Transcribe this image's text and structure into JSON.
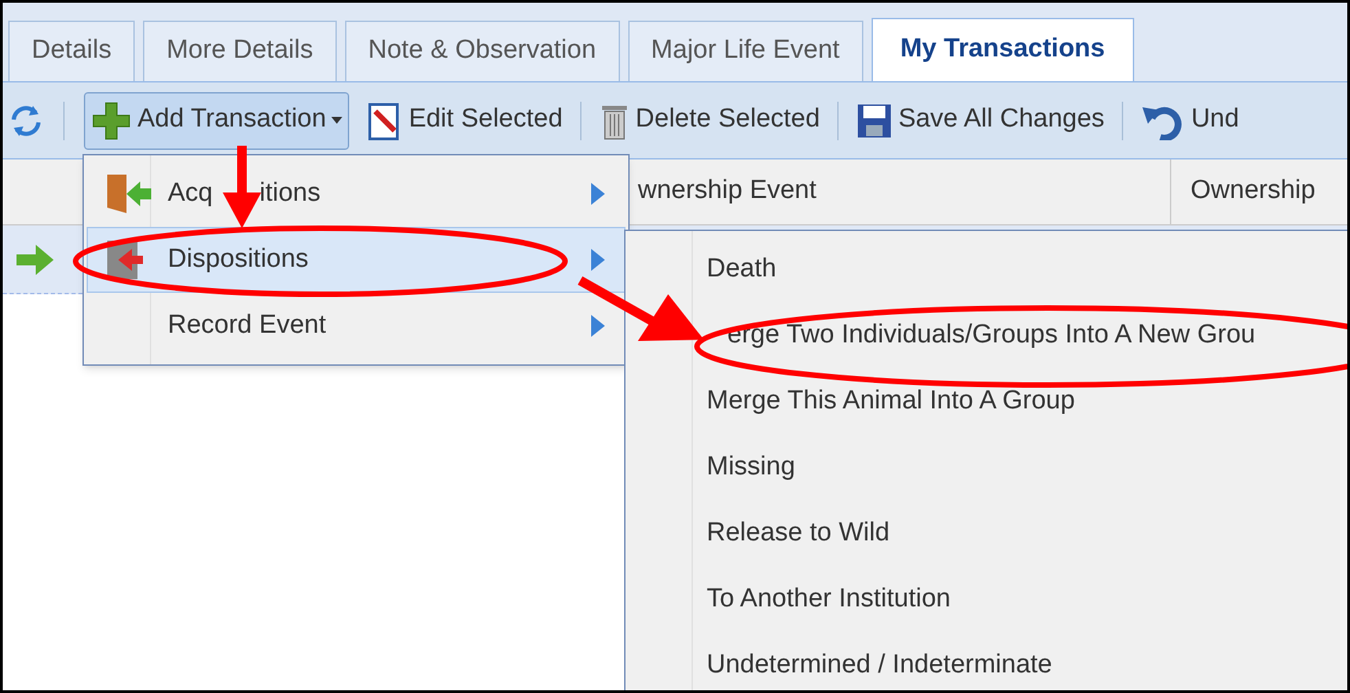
{
  "tabs": [
    {
      "label": "Details",
      "selected": false
    },
    {
      "label": "More Details",
      "selected": false
    },
    {
      "label": "Note & Observation",
      "selected": false
    },
    {
      "label": "Major Life Event",
      "selected": false
    },
    {
      "label": "My Transactions",
      "selected": true
    }
  ],
  "toolbar": {
    "buttons": [
      {
        "label": "Add Transaction",
        "pressed": true
      },
      {
        "label": "Edit Selected",
        "pressed": false
      },
      {
        "label": "Delete Selected",
        "pressed": false
      },
      {
        "label": "Save All Changes",
        "pressed": false
      },
      {
        "label": "Und",
        "pressed": false
      }
    ]
  },
  "grid": {
    "columns": [
      "wnership Event",
      "Ownership"
    ]
  },
  "menu": {
    "items": [
      {
        "label": [
          "Acq",
          "itions"
        ],
        "selected": false
      },
      {
        "label": [
          "Dispositions"
        ],
        "selected": true
      },
      {
        "label": [
          "Record Event"
        ],
        "selected": false
      }
    ]
  },
  "submenu": {
    "items": [
      {
        "label": "Death",
        "selected": false
      },
      {
        "label": "erge Two Individuals/Groups Into A New Grou",
        "selected": false
      },
      {
        "label": "Merge This Animal Into A Group",
        "selected": false
      },
      {
        "label": "Missing",
        "selected": false
      },
      {
        "label": "Release to Wild",
        "selected": false
      },
      {
        "label": "To Another Institution",
        "selected": false
      },
      {
        "label": "Undetermined / Indeterminate",
        "selected": false
      }
    ]
  }
}
